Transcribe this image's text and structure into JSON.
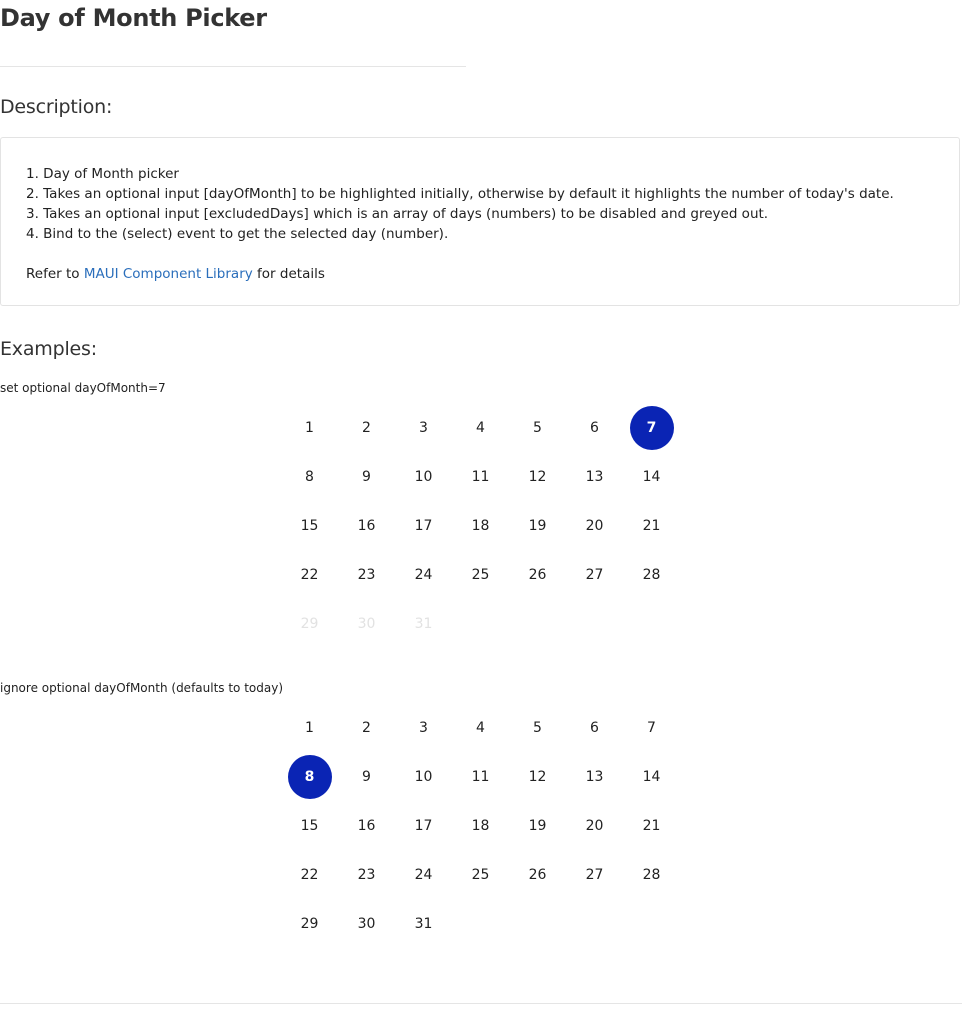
{
  "header": {
    "title": "Day of Month Picker"
  },
  "description": {
    "heading": "Description:",
    "items": [
      "1. Day of Month picker",
      "2. Takes an optional input [dayOfMonth] to be highlighted initially, otherwise by default it highlights the number of today's date.",
      "3. Takes an optional input [excludedDays] which is an array of days (numbers) to be disabled and greyed out.",
      "4. Bind to the (select) event to get the selected day (number)."
    ],
    "refer_prefix": "Refer to ",
    "refer_link": "MAUI Component Library",
    "refer_suffix": " for details"
  },
  "examples": {
    "heading": "Examples:",
    "list": [
      {
        "label": "set optional dayOfMonth=7",
        "selected_day": 7,
        "disabled_days": [
          29,
          30,
          31
        ]
      },
      {
        "label": "ignore optional dayOfMonth (defaults to today)",
        "selected_day": 8,
        "disabled_days": []
      }
    ]
  },
  "days": [
    "1",
    "2",
    "3",
    "4",
    "5",
    "6",
    "7",
    "8",
    "9",
    "10",
    "11",
    "12",
    "13",
    "14",
    "15",
    "16",
    "17",
    "18",
    "19",
    "20",
    "21",
    "22",
    "23",
    "24",
    "25",
    "26",
    "27",
    "28",
    "29",
    "30",
    "31"
  ],
  "colors": {
    "selected_bg": "#0a24b4",
    "disabled_text": "#e2e2e2",
    "link": "#2a6ebb"
  }
}
